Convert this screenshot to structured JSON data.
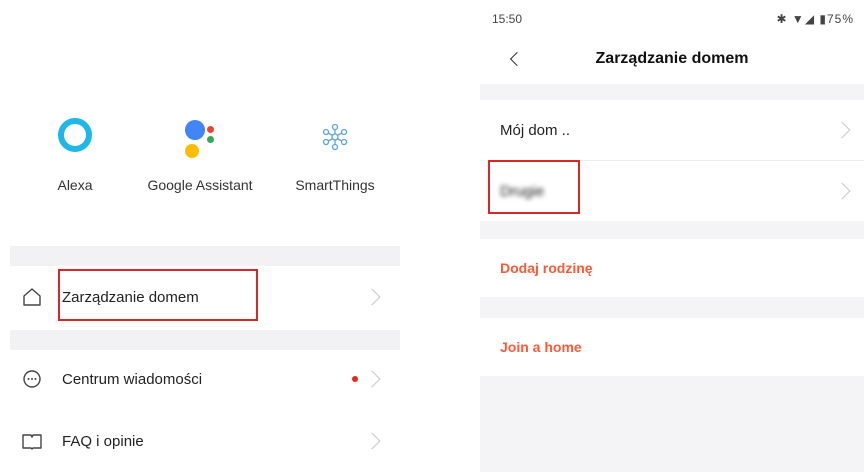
{
  "left": {
    "assistants": [
      {
        "name": "Alexa"
      },
      {
        "name": "Google Assistant"
      },
      {
        "name": "SmartThings"
      }
    ],
    "menu": {
      "home_management": "Zarządzanie domem",
      "message_center": "Centrum wiadomości",
      "faq": "FAQ i opinie"
    }
  },
  "right": {
    "status": {
      "time": "15:50",
      "indicators": "✱ ▼◢ ▮75%"
    },
    "nav": {
      "title": "Zarządzanie domem"
    },
    "homes": [
      "Mój dom ..",
      "Drugie"
    ],
    "actions": {
      "add_family": "Dodaj rodzinę",
      "join_home": "Join a home"
    }
  },
  "colors": {
    "accent": "#ff5a36",
    "highlight": "#d62828",
    "alexa": "#1fb7e8"
  }
}
